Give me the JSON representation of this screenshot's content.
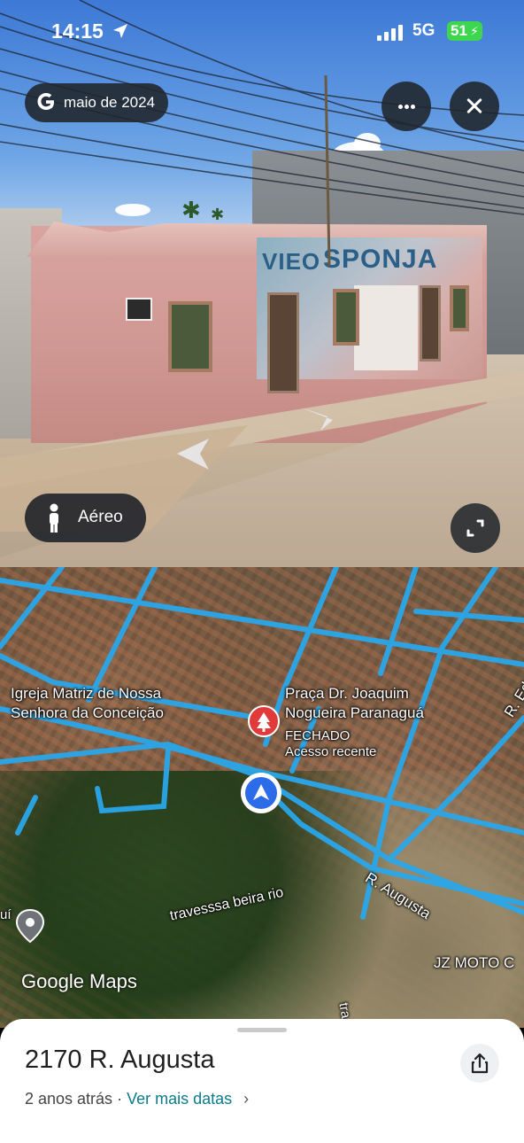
{
  "status_bar": {
    "time": "14:15",
    "network": "5G",
    "battery": "51",
    "icons": [
      "location-arrow-icon",
      "signal-icon",
      "battery-charging-icon"
    ]
  },
  "street_view": {
    "date_label": "maio de 2024",
    "mode_button_label": "Aéreo",
    "icons": [
      "google-g-icon",
      "more-icon",
      "close-icon",
      "person-icon",
      "expand-icon",
      "nav-arrow-icon"
    ],
    "storefront_text": [
      "VIEO",
      "SPONJA"
    ]
  },
  "map": {
    "labels": {
      "church": "Igreja Matriz de Nossa\nSenhora da Conceição",
      "plaza_name": "Praça Dr. Joaquim\nNogueira Paranaguá",
      "plaza_status": "FECHADO",
      "plaza_recent": "Acesso recente",
      "street_augusta": "R. Augusta",
      "street_travessa": "travesssa beira rio",
      "street_ed": "R. Ed",
      "street_tra": "tra",
      "business": "JZ MOTO C",
      "left_edge": "uí"
    },
    "logo": "Google Maps"
  },
  "sheet": {
    "address": "2170 R. Augusta",
    "age": "2 anos atrás",
    "separator": "·",
    "more_dates": "Ver mais datas",
    "chevron": "›"
  },
  "colors": {
    "road_highlight": "#2aa7ea",
    "accent_link": "#0b7a8a",
    "battery": "#3ed54f",
    "nav_blue": "#2d6ce8",
    "place_red": "#e03a3a"
  }
}
